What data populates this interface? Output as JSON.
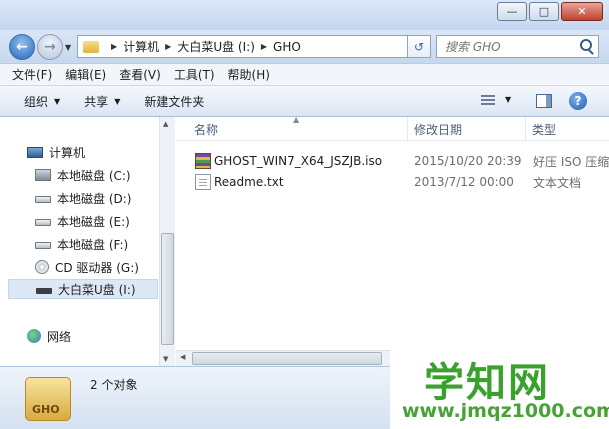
{
  "window": {
    "min_icon": "minimize-icon",
    "max_icon": "maximize-icon",
    "close_icon": "close-icon"
  },
  "address": {
    "crumbs": [
      "计算机",
      "大白菜U盘 (I:)",
      "GHO"
    ]
  },
  "search": {
    "placeholder": "搜索 GHO"
  },
  "menu": [
    "文件(F)",
    "编辑(E)",
    "查看(V)",
    "工具(T)",
    "帮助(H)"
  ],
  "toolbar": {
    "organize": "组织",
    "share": "共享",
    "new_folder": "新建文件夹"
  },
  "nav_tree": {
    "computer": "计算机",
    "drives": [
      "本地磁盘 (C:)",
      "本地磁盘 (D:)",
      "本地磁盘 (E:)",
      "本地磁盘 (F:)",
      "CD 驱动器 (G:)",
      "大白菜U盘 (I:)"
    ],
    "network": "网络"
  },
  "columns": {
    "name": "名称",
    "date": "修改日期",
    "type": "类型"
  },
  "files": [
    {
      "name": "GHOST_WIN7_X64_JSZJB.iso",
      "date": "2015/10/20 20:39",
      "type": "好压 ISO 压缩"
    },
    {
      "name": "Readme.txt",
      "date": "2013/7/12 00:00",
      "type": "文本文档"
    }
  ],
  "details": {
    "folder_label": "GHO",
    "count": "2 个对象"
  },
  "watermark": {
    "title": "学知网",
    "url": "www.jmqz1000.com"
  },
  "colors": {
    "accent": "#2a64b3",
    "watermark": "#3aa12d"
  }
}
